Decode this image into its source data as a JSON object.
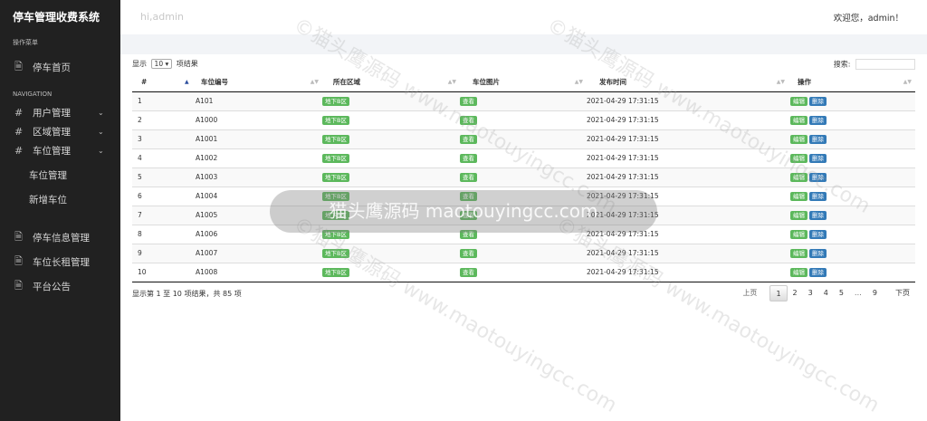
{
  "sidebar": {
    "brand": "停车管理收费系统",
    "section_menu": "操作菜单",
    "home": "停车首页",
    "section_nav": "NAVIGATION",
    "groups": [
      {
        "label": "用户管理",
        "icon": "hash-icon"
      },
      {
        "label": "区域管理",
        "icon": "hash-icon"
      },
      {
        "label": "车位管理",
        "icon": "hash-icon"
      }
    ],
    "subitems": [
      "车位管理",
      "新增车位"
    ],
    "bottom_items": [
      "停车信息管理",
      "车位长租管理",
      "平台公告"
    ]
  },
  "header": {
    "hi": "hi,admin",
    "welcome": "欢迎您，admin！"
  },
  "table_controls": {
    "show_prefix": "显示",
    "page_length": "10",
    "show_suffix": "项结果",
    "search_label": "搜索:"
  },
  "columns": [
    "#",
    "车位编号",
    "所在区域",
    "车位图片",
    "发布时间",
    "操作"
  ],
  "rows": [
    {
      "num": "1",
      "code": "A101",
      "area": "地下B区",
      "img": "查看",
      "time": "2021-04-29 17:31:15"
    },
    {
      "num": "2",
      "code": "A1000",
      "area": "地下B区",
      "img": "查看",
      "time": "2021-04-29 17:31:15"
    },
    {
      "num": "3",
      "code": "A1001",
      "area": "地下B区",
      "img": "查看",
      "time": "2021-04-29 17:31:15"
    },
    {
      "num": "4",
      "code": "A1002",
      "area": "地下B区",
      "img": "查看",
      "time": "2021-04-29 17:31:15"
    },
    {
      "num": "5",
      "code": "A1003",
      "area": "地下B区",
      "img": "查看",
      "time": "2021-04-29 17:31:15"
    },
    {
      "num": "6",
      "code": "A1004",
      "area": "地下B区",
      "img": "查看",
      "time": "2021-04-29 17:31:15"
    },
    {
      "num": "7",
      "code": "A1005",
      "area": "地下B区",
      "img": "查看",
      "time": "2021-04-29 17:31:15"
    },
    {
      "num": "8",
      "code": "A1006",
      "area": "地下B区",
      "img": "查看",
      "time": "2021-04-29 17:31:15"
    },
    {
      "num": "9",
      "code": "A1007",
      "area": "地下B区",
      "img": "查看",
      "time": "2021-04-29 17:31:15"
    },
    {
      "num": "10",
      "code": "A1008",
      "area": "地下B区",
      "img": "查看",
      "time": "2021-04-29 17:31:15"
    }
  ],
  "actions": {
    "edit": "编辑",
    "delete": "删除"
  },
  "footer": {
    "info": "显示第 1 至 10 项结果，共 85 项",
    "prev": "上页",
    "pages": [
      "1",
      "2",
      "3",
      "4",
      "5",
      "…",
      "9"
    ],
    "next": "下页"
  },
  "overlay_text": "猫头鹰源码 maotouyingcc.com",
  "watermark_text": "©猫头鹰源码 www.maotouyingcc.com",
  "colors": {
    "sidebar_bg": "#212121",
    "badge_green": "#5cb85c",
    "badge_blue": "#337ab7"
  }
}
